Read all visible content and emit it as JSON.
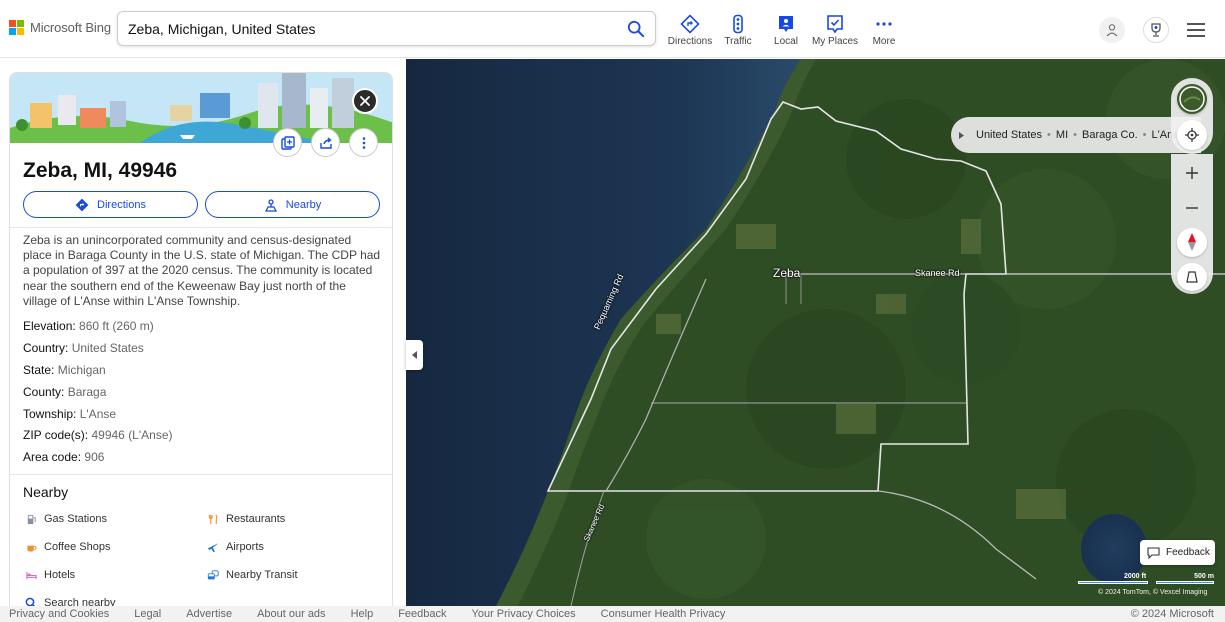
{
  "header": {
    "logo_text": "Microsoft Bing",
    "search_value": "Zeba, Michigan, United States",
    "nav": [
      {
        "label": "Directions",
        "icon": "directions-icon"
      },
      {
        "label": "Traffic",
        "icon": "traffic-icon"
      },
      {
        "label": "Local",
        "icon": "local-icon"
      },
      {
        "label": "My Places",
        "icon": "my-places-icon"
      },
      {
        "label": "More",
        "icon": "more-icon"
      }
    ]
  },
  "panel": {
    "title": "Zeba, MI, 49946",
    "directions_label": "Directions",
    "nearby_label": "Nearby",
    "description": "Zeba is an unincorporated community and census-designated place in Baraga County in the U.S. state of Michigan. The CDP had a population of 397 at the 2020 census. The community is located near the southern end of the Keweenaw Bay just north of the village of L'Anse within L'Anse Township.",
    "facts": [
      {
        "key": "Elevation:",
        "value": "860 ft (260 m)"
      },
      {
        "key": "Country:",
        "value": "United States"
      },
      {
        "key": "State:",
        "value": "Michigan"
      },
      {
        "key": "County:",
        "value": "Baraga"
      },
      {
        "key": "Township:",
        "value": "L'Anse"
      },
      {
        "key": "ZIP code(s):",
        "value": "49946 (L'Anse)"
      },
      {
        "key": "Area code:",
        "value": "906"
      }
    ],
    "nearby_title": "Nearby",
    "nearby": [
      {
        "label": "Gas Stations",
        "icon": "gas-station-icon"
      },
      {
        "label": "Restaurants",
        "icon": "restaurant-icon"
      },
      {
        "label": "Coffee Shops",
        "icon": "coffee-icon"
      },
      {
        "label": "Airports",
        "icon": "airplane-icon"
      },
      {
        "label": "Hotels",
        "icon": "hotel-icon"
      },
      {
        "label": "Nearby Transit",
        "icon": "transit-icon"
      }
    ],
    "search_nearby": "Search nearby"
  },
  "map": {
    "breadcrumb": [
      "United States",
      "MI",
      "Baraga Co.",
      "L'Anse"
    ],
    "labels": {
      "town": "Zeba",
      "road_skanee_east": "Skanee Rd",
      "road_pequaming": "Pequaming Rd",
      "road_skanee_south": "Skanee Rd"
    },
    "feedback_label": "Feedback",
    "scale_ft": "2000 ft",
    "scale_m": "500 m",
    "attribution": "© 2024 TomTom, © Vexcel Imaging"
  },
  "footer": {
    "links": [
      "Privacy and Cookies",
      "Legal",
      "Advertise",
      "About our ads",
      "Help",
      "Feedback",
      "Your Privacy Choices",
      "Consumer Health Privacy"
    ],
    "copyright": "© 2024 Microsoft"
  },
  "colors": {
    "accent": "#174ae4",
    "water": "#1b3352",
    "forest": "#2f4d25"
  }
}
